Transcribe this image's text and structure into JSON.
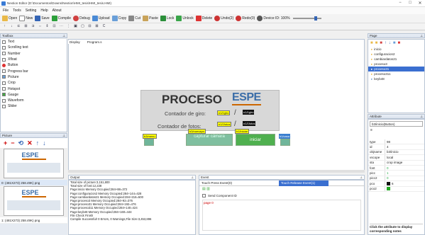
{
  "window": {
    "title": "Nextion Editor (D:\\Documentos\\Downs\\Nextion\\HMI_tesis\\HMI_tesis.HMI)"
  },
  "menu": [
    "File",
    "Tools",
    "Setting",
    "Help",
    "About"
  ],
  "toolbar": [
    {
      "label": "Open",
      "icon": "folder-icon"
    },
    {
      "label": "New",
      "icon": "new-file-icon"
    },
    {
      "label": "Save",
      "icon": "save-icon"
    },
    {
      "label": "Compile",
      "icon": "compile-icon"
    },
    {
      "label": "Debug",
      "icon": "debug-icon"
    },
    {
      "label": "Upload",
      "icon": "upload-icon"
    },
    {
      "label": "Copy",
      "icon": "copy-icon"
    },
    {
      "label": "Cut",
      "icon": "cut-icon"
    },
    {
      "label": "Paste",
      "icon": "paste-icon"
    },
    {
      "label": "Lock",
      "icon": "lock-icon"
    },
    {
      "label": "Unlock",
      "icon": "unlock-icon"
    },
    {
      "label": "Delete",
      "icon": "delete-icon"
    },
    {
      "label": "Undo(2)",
      "icon": "undo-icon"
    },
    {
      "label": "Redo(0)",
      "icon": "redo-icon"
    },
    {
      "label": "Device ID: 100%",
      "icon": "device-icon"
    }
  ],
  "toolbox": {
    "title": "Toolbox",
    "items": [
      "Text",
      "Scrolling text",
      "Number",
      "Xfloat",
      "Button",
      "Progress bar",
      "Picture",
      "Crop",
      "Hotspot",
      "Gauge",
      "Waveform",
      "Slider"
    ]
  },
  "picture": {
    "title": "Picture",
    "items": [
      {
        "caption": "0: (481X273) 258.49K) png",
        "logo": "ESPE"
      },
      {
        "caption": "1: (481X273) 258.49K) png",
        "logo": "ESPE"
      }
    ]
  },
  "canvas": {
    "tabs": [
      "Display",
      "Program.s"
    ],
    "title": "PROCESO",
    "logo": "ESPE",
    "giro_label": "Contador de giro:",
    "fotos_label": "Contador de fotos:",
    "giro_val": "n1/1giro",
    "giro_max": "n1/1giro",
    "fotos_val": "n1/1fotos",
    "fotos_max": "n1/1fotos",
    "b3_label": "b3/menu",
    "cap_label": "b3/nuevapn",
    "cap_text": "capturar cámara",
    "start_label": "b1/iniciar",
    "start_text": "iniciar",
    "home_label": "b1/casa"
  },
  "output": {
    "title": "Output",
    "lines": [
      "Total size of picture:3,151,800",
      "Total size of font:12,228",
      "Page:inicio Memory Occupied:284+88=372",
      "Page:configuracion2 Memory Occupied:284+144=428",
      "Page:cambiardatos21 Memory Occupied:284+216=500",
      "Page:proceso3 Memory Occupied:284+92=376",
      "Page:proceso31 Memory Occupied:284+192=476",
      "Page:proceso311 Memory Occupied:284+140=424",
      "Page:keyb48 Memory Occupied:284+160=444",
      "File Check Finish",
      "Compile Successful! 0 Errors, 0 Warnings,File Size:3,453,896"
    ]
  },
  "event": {
    "title": "Event",
    "tabs": [
      "Touch Press Event(0)",
      "Touch Release Event(1)"
    ],
    "checkbox": "Send Component ID",
    "code": "page 0"
  },
  "page": {
    "title": "Page",
    "items": [
      "inicio",
      "configuracion2",
      "cambiardatos21",
      "proceso3",
      "proceso31",
      "proceso311",
      "keyb48"
    ],
    "selected": 4
  },
  "attribute": {
    "title": "Attribute",
    "selector": "b3/inicio(Button)",
    "rows": [
      {
        "k": "type",
        "v": "98"
      },
      {
        "k": "id",
        "v": "4"
      },
      {
        "k": "objname",
        "v": "b3/inicio"
      },
      {
        "k": "vscope",
        "v": "local"
      },
      {
        "k": "sta",
        "v": "crop image"
      },
      {
        "k": "font",
        "v": "0"
      },
      {
        "k": "picc",
        "v": "1"
      },
      {
        "k": "picc2",
        "v": "0"
      },
      {
        "k": "pco",
        "v": "6"
      },
      {
        "k": "pco2",
        "v": ""
      }
    ],
    "help": "Click the attribute to display corresponding notes"
  }
}
